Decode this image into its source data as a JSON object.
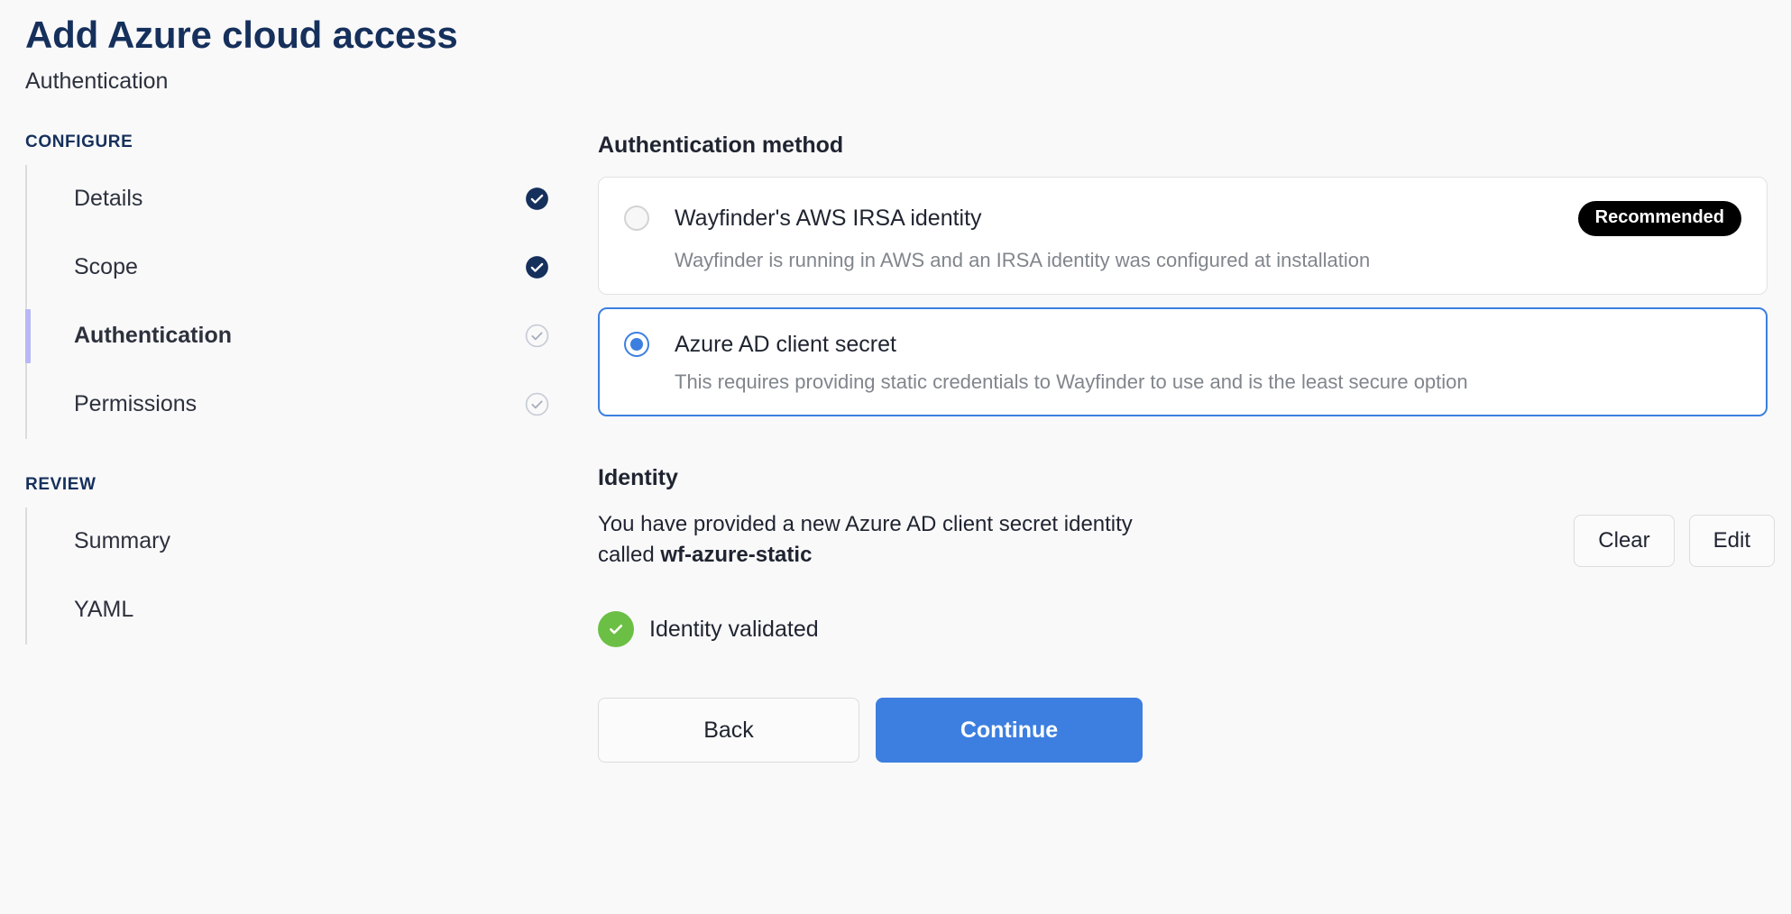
{
  "header": {
    "title": "Add Azure cloud access",
    "subtitle": "Authentication"
  },
  "sidebar": {
    "sections": [
      {
        "heading": "CONFIGURE",
        "items": [
          {
            "label": "Details",
            "state": "complete"
          },
          {
            "label": "Scope",
            "state": "complete"
          },
          {
            "label": "Authentication",
            "state": "current"
          },
          {
            "label": "Permissions",
            "state": "incomplete"
          }
        ]
      },
      {
        "heading": "REVIEW",
        "items": [
          {
            "label": "Summary",
            "state": "none"
          },
          {
            "label": "YAML",
            "state": "none"
          }
        ]
      }
    ]
  },
  "main": {
    "auth_method_title": "Authentication method",
    "options": [
      {
        "label": "Wayfinder's AWS IRSA identity",
        "description": "Wayfinder is running in AWS and an IRSA identity was configured at installation",
        "badge": "Recommended",
        "selected": false
      },
      {
        "label": "Azure AD client secret",
        "description": "This requires providing static credentials to Wayfinder to use and is the least secure option",
        "badge": "",
        "selected": true
      }
    ],
    "identity": {
      "title": "Identity",
      "text_prefix": "You have provided a new Azure AD client secret identity called ",
      "identity_name": "wf-azure-static",
      "clear_label": "Clear",
      "edit_label": "Edit",
      "validated_label": "Identity validated"
    },
    "footer": {
      "back_label": "Back",
      "continue_label": "Continue"
    }
  },
  "colors": {
    "title_navy": "#16305c",
    "accent_blue": "#3d7fe0",
    "active_bar": "#b9b8f5",
    "success_green": "#6cbf45",
    "badge_black": "#000000",
    "page_background": "#f9f9fa"
  }
}
